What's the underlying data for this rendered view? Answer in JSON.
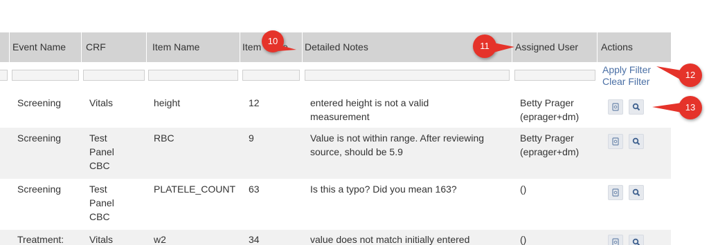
{
  "columns": {
    "event_name": "Event Name",
    "crf": "CRF",
    "item_name": "Item Name",
    "item_value": "Item Value",
    "detailed_notes": "Detailed Notes",
    "assigned_user": "Assigned User",
    "actions": "Actions"
  },
  "filter": {
    "apply_label": "Apply Filter",
    "clear_label": "Clear Filter"
  },
  "rows": [
    {
      "event_name": "Screening",
      "crf": "Vitals",
      "item_name": "height",
      "item_value": "12",
      "detailed_notes": "entered height is not a valid measurement",
      "assigned_user": "Betty Prager (eprager+dm)"
    },
    {
      "event_name": "Screening",
      "crf": "Test Panel CBC",
      "item_name": "RBC",
      "item_value": "9",
      "detailed_notes": "Value is not within range. After reviewing source, should be 5.9",
      "assigned_user": "Betty Prager (eprager+dm)"
    },
    {
      "event_name": "Screening",
      "crf": "Test Panel CBC",
      "item_name": "PLATELE_COUNT",
      "item_value": "63",
      "detailed_notes": "Is this a typo? Did you mean 163?",
      "assigned_user": "()"
    },
    {
      "event_name": "Treatment:",
      "crf": "Vitals",
      "item_name": "w2",
      "item_value": "34",
      "detailed_notes": "value does not match initially entered",
      "assigned_user": "()"
    }
  ],
  "callouts": [
    "10",
    "11",
    "12",
    "13"
  ],
  "icons": {
    "view_note": "note-view-icon",
    "search": "magnifier-icon"
  },
  "colors": {
    "header_bg": "#d3d3d3",
    "alt_row_bg": "#f1f1f1",
    "link": "#4a6fa5",
    "callout": "#e5332a"
  }
}
